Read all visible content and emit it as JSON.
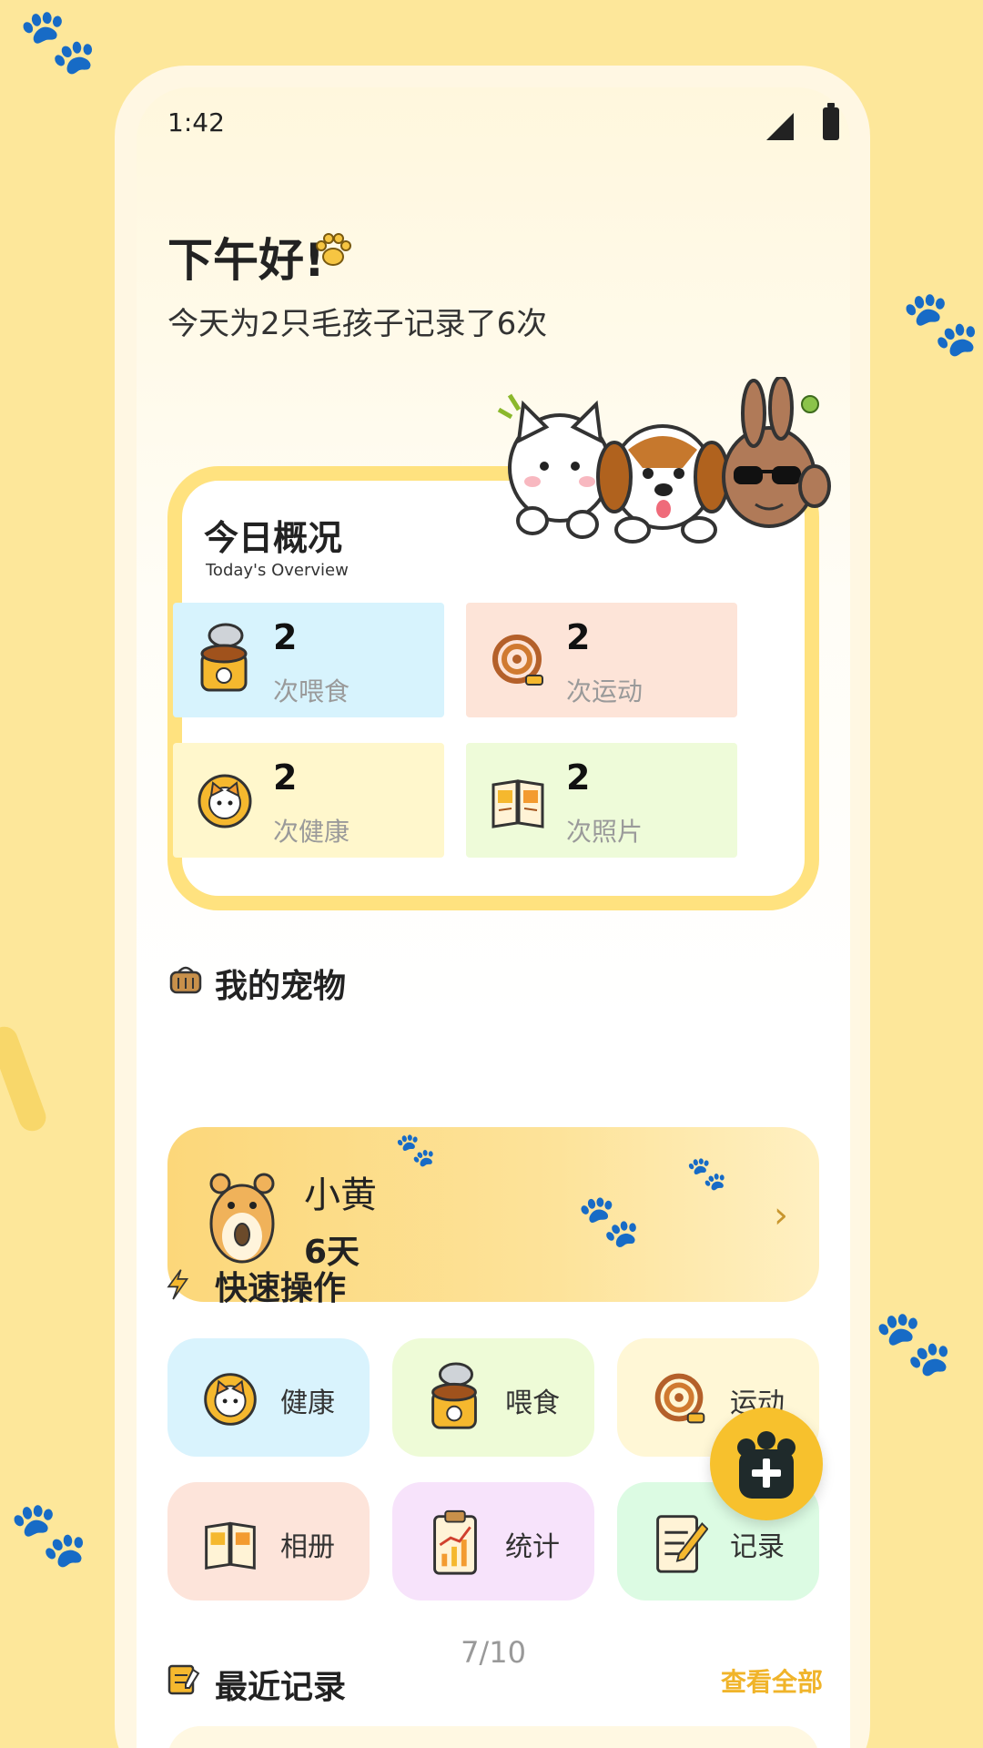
{
  "status_bar": {
    "time": "1:42"
  },
  "greeting": {
    "title": "下午好!",
    "subtitle": "今天为2只毛孩子记录了6次"
  },
  "overview": {
    "title": "今日概况",
    "subtitle": "Today's Overview",
    "stats": [
      {
        "value": "2",
        "label": "次喂食",
        "icon": "pet-food-can-icon",
        "bg": "#d7f3fd"
      },
      {
        "value": "2",
        "label": "次运动",
        "icon": "leash-icon",
        "bg": "#fde4d8"
      },
      {
        "value": "2",
        "label": "次健康",
        "icon": "cat-health-icon",
        "bg": "#fff7cc"
      },
      {
        "value": "2",
        "label": "次照片",
        "icon": "photo-album-icon",
        "bg": "#eefbd9"
      }
    ]
  },
  "my_pets": {
    "title": "我的宠物",
    "pet": {
      "name": "小黄",
      "days": "6天"
    }
  },
  "quick_actions": {
    "title": "快速操作",
    "items": [
      {
        "label": "健康",
        "icon": "cat-health-icon",
        "bg": "#d9f3fd"
      },
      {
        "label": "喂食",
        "icon": "pet-food-can-icon",
        "bg": "#eefbd7"
      },
      {
        "label": "运动",
        "icon": "leash-icon",
        "bg": "#fff7d6"
      },
      {
        "label": "相册",
        "icon": "photo-album-icon",
        "bg": "#fde4da"
      },
      {
        "label": "统计",
        "icon": "statistics-clipboard-icon",
        "bg": "#f7e3fb"
      },
      {
        "label": "记录",
        "icon": "notepad-pencil-icon",
        "bg": "#dcfbe3"
      }
    ]
  },
  "pager": {
    "text": "7/10"
  },
  "recent": {
    "title": "最近记录",
    "view_all": "查看全部"
  }
}
